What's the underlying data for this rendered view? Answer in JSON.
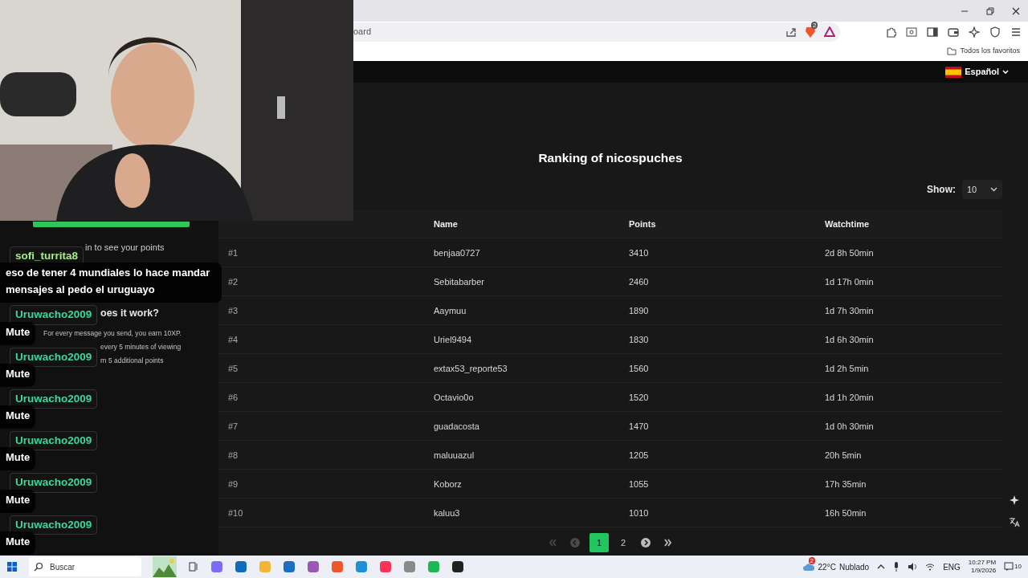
{
  "browser": {
    "address": "oard",
    "shield_badge": "2",
    "bookmarks_label": "Todos los favoritos"
  },
  "site": {
    "language": "Español",
    "title": "Ranking of nicospuches",
    "show_label": "Show:",
    "show_value": "10"
  },
  "sidebar": {
    "texts": [
      {
        "kind": "note",
        "text": "in to see your points"
      },
      {
        "kind": "heading",
        "text": "oes it work?"
      },
      {
        "kind": "small",
        "text": "For every message you send, you earn 10XP."
      },
      {
        "kind": "small",
        "text": "every 5 minutes of viewing"
      },
      {
        "kind": "small",
        "text": "rn 5 additional points"
      }
    ]
  },
  "table": {
    "columns": [
      "",
      "Name",
      "Points",
      "Watchtime"
    ],
    "rows": [
      {
        "rank": "#1",
        "name": "benjaa0727",
        "points": "3410",
        "watchtime": "2d 8h 50min"
      },
      {
        "rank": "#2",
        "name": "Sebitabarber",
        "points": "2460",
        "watchtime": "1d 17h 0min"
      },
      {
        "rank": "#3",
        "name": "Aaymuu",
        "points": "1890",
        "watchtime": "1d 7h 30min"
      },
      {
        "rank": "#4",
        "name": "Uriel9494",
        "points": "1830",
        "watchtime": "1d 6h 30min"
      },
      {
        "rank": "#5",
        "name": "extax53_reporte53",
        "points": "1560",
        "watchtime": "1d 2h 5min"
      },
      {
        "rank": "#6",
        "name": "Octavio0o",
        "points": "1520",
        "watchtime": "1d 1h 20min"
      },
      {
        "rank": "#7",
        "name": "guadacosta",
        "points": "1470",
        "watchtime": "1d 0h 30min"
      },
      {
        "rank": "#8",
        "name": "maluuazul",
        "points": "1205",
        "watchtime": "20h 5min"
      },
      {
        "rank": "#9",
        "name": "Koborz",
        "points": "1055",
        "watchtime": "17h 35min"
      },
      {
        "rank": "#10",
        "name": "kaluu3",
        "points": "1010",
        "watchtime": "16h 50min"
      }
    ]
  },
  "pagination": {
    "controls": [
      {
        "kind": "first",
        "disabled": true
      },
      {
        "kind": "prev",
        "disabled": true
      },
      {
        "kind": "page",
        "label": "1",
        "selected": true
      },
      {
        "kind": "page",
        "label": "2",
        "selected": false
      },
      {
        "kind": "next",
        "disabled": false
      },
      {
        "kind": "last",
        "disabled": false
      }
    ]
  },
  "chat": [
    {
      "user": "sofi_turrita8",
      "color": "#a6ec84",
      "message": "eso de tener 4 mundiales lo hace mandar mensajes al pedo el uruguayo"
    },
    {
      "user": "Uruwacho2009",
      "color": "#3ad89b",
      "message": "Mute"
    },
    {
      "user": "Uruwacho2009",
      "color": "#3ad89b",
      "message": "Mute"
    },
    {
      "user": "Uruwacho2009",
      "color": "#3ad89b",
      "message": "Mute"
    },
    {
      "user": "Uruwacho2009",
      "color": "#3ad89b",
      "message": "Mute"
    },
    {
      "user": "Uruwacho2009",
      "color": "#3ad89b",
      "message": "Mute"
    },
    {
      "user": "Uruwacho2009",
      "color": "#3ad89b",
      "message": "Mute"
    }
  ],
  "taskbar": {
    "search_placeholder": "Buscar",
    "weather_badge": "2",
    "temperature": "22°C",
    "weather": "Nublado",
    "language": "ENG",
    "time": "10:27 PM",
    "date": "1/9/2026",
    "notifications": "10"
  }
}
